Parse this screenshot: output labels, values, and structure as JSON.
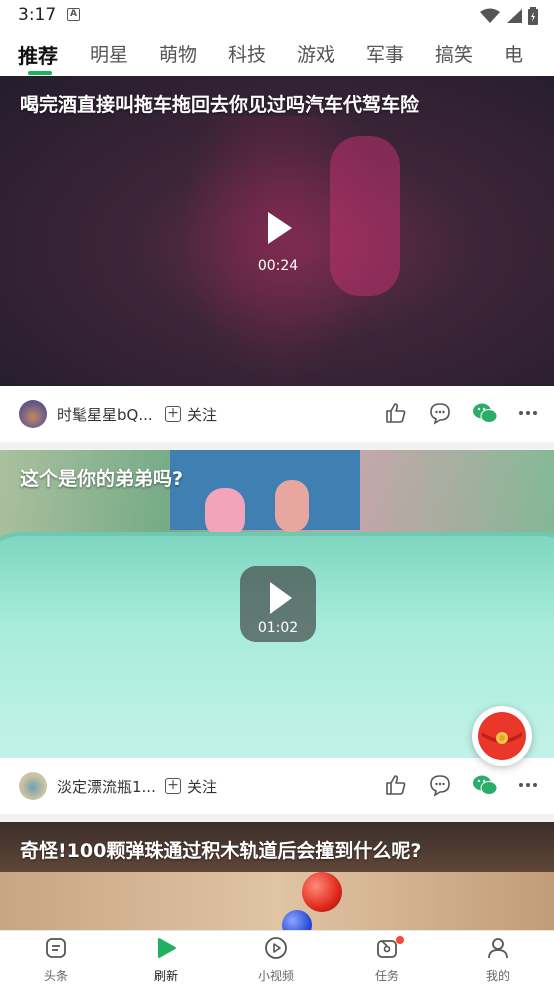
{
  "status_bar": {
    "time": "3:17",
    "a_label": "A"
  },
  "tabs": [
    {
      "label": "推荐",
      "active": true
    },
    {
      "label": "明星"
    },
    {
      "label": "萌物"
    },
    {
      "label": "科技"
    },
    {
      "label": "游戏"
    },
    {
      "label": "军事"
    },
    {
      "label": "搞笑"
    },
    {
      "label": "电"
    }
  ],
  "feed": [
    {
      "title": "喝完酒直接叫拖车拖回去你见过吗汽车代驾车险",
      "duration": "00:24",
      "author": "时髦星星bQ...",
      "follow_label": "关注"
    },
    {
      "title": "这个是你的弟弟吗?",
      "duration": "01:02",
      "author": "淡定漂流瓶1...",
      "follow_label": "关注"
    },
    {
      "title": "奇怪!100颗弹珠通过积木轨道后会撞到什么呢?"
    }
  ],
  "bottom_nav": [
    {
      "label": "头条",
      "icon": "headline-icon"
    },
    {
      "label": "刷新",
      "icon": "refresh-play-icon",
      "active": true
    },
    {
      "label": "小视频",
      "icon": "small-video-icon"
    },
    {
      "label": "任务",
      "icon": "task-icon",
      "badge": true
    },
    {
      "label": "我的",
      "icon": "profile-icon"
    }
  ],
  "colors": {
    "accent": "#1fb160",
    "badge": "#f04a3c",
    "wechat": "#2aae67"
  }
}
